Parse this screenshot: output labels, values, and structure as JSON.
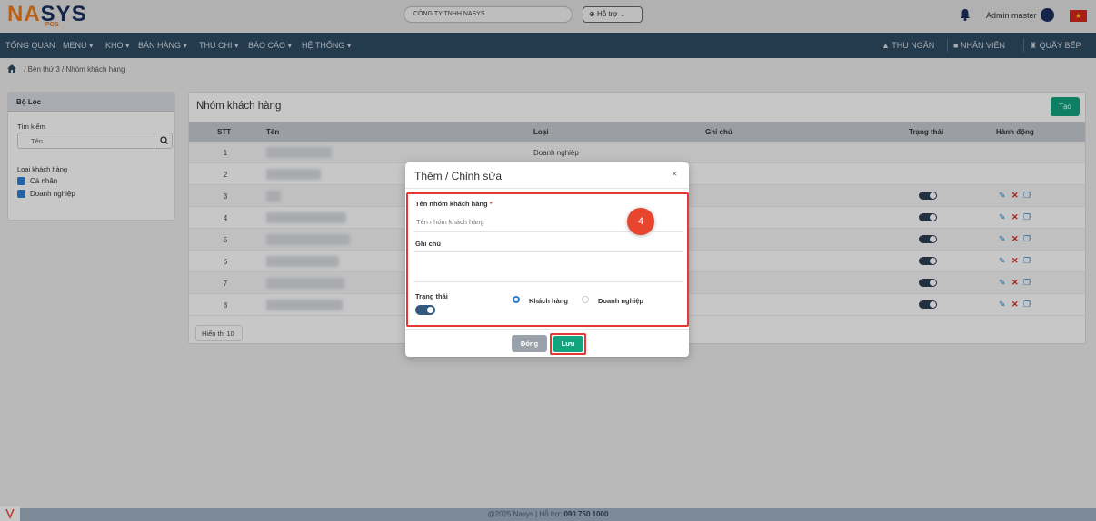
{
  "header": {
    "logo_main": "NA",
    "logo_accent": "SYS",
    "logo_sub": "POS",
    "company": "CÔNG TY TNHH NASYS",
    "support": "Hỗ trợ",
    "user": "Admin master"
  },
  "nav": {
    "items": [
      "TỔNG QUAN",
      "MENU ▾",
      "KHO ▾",
      "BÁN HÀNG ▾",
      "THU CHI ▾",
      "BÁO CÁO ▾",
      "HỆ THỐNG ▾"
    ],
    "right": [
      "THU NGÂN",
      "NHÂN VIÊN",
      "QUẦY BẾP"
    ]
  },
  "breadcrumb": "/  Bên thứ 3  /  Nhóm khách hàng",
  "filter": {
    "title": "Bộ Lọc",
    "search_label": "Tìm kiếm",
    "search_placeholder": "Tên",
    "type_label": "Loại khách hàng",
    "options": [
      "Cá nhân",
      "Doanh nghiệp"
    ]
  },
  "table": {
    "title": "Nhóm khách hàng",
    "create_label": "Tạo",
    "columns": [
      "STT",
      "Tên",
      "Loại",
      "Ghi chú",
      "Trạng thái",
      "Hành động"
    ],
    "rows": [
      {
        "stt": "1",
        "type": "Doanh nghiệp"
      },
      {
        "stt": "2",
        "type": ""
      },
      {
        "stt": "3",
        "type": ""
      },
      {
        "stt": "4",
        "type": ""
      },
      {
        "stt": "5",
        "type": ""
      },
      {
        "stt": "6",
        "type": ""
      },
      {
        "stt": "7",
        "type": ""
      },
      {
        "stt": "8",
        "type": ""
      }
    ],
    "page_size": "Hiển thị 10"
  },
  "modal": {
    "title": "Thêm / Chỉnh sửa",
    "close": "×",
    "name_label": "Tên nhóm khách hàng",
    "required": "*",
    "name_placeholder": "Tên nhóm khách hàng",
    "note_label": "Ghi chú",
    "status_label": "Trạng thái",
    "radio_customer": "Khách hàng",
    "radio_business": "Doanh nghiệp",
    "step_badge": "4",
    "btn_close": "Đóng",
    "btn_save": "Lưu"
  },
  "footer": {
    "text": "@2025 Nasys | Hỗ trợ: ",
    "phone": "090 750 1000"
  },
  "colors": {
    "nav": "#2f4b63",
    "accent_green": "#14a37f",
    "highlight_red": "#e53935"
  }
}
